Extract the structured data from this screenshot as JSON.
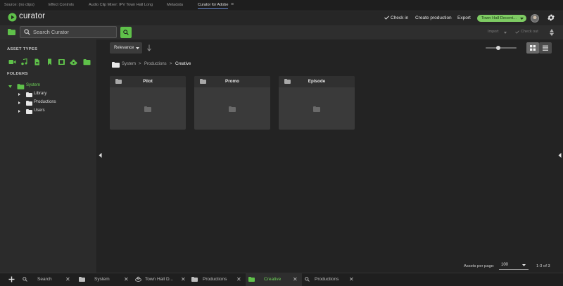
{
  "panel_tabs": [
    "Source: (no clips)",
    "Effect Controls",
    "Audio Clip Mixer: IPV Town Hall Long",
    "Metadata",
    "Curator for Adobe"
  ],
  "panel_menu_glyph": "≡",
  "app": {
    "logo_text": "curator"
  },
  "header": {
    "check_in": "Check in",
    "create_production": "Create production",
    "export": "Export",
    "user_selector": "Town Hall Decent..."
  },
  "search": {
    "placeholder": "Search Curator",
    "value": ""
  },
  "actions": {
    "import": "Import",
    "check_out": "Check out"
  },
  "sidebar": {
    "asset_types_label": "ASSET TYPES",
    "asset_type_icons": [
      "video-icon",
      "audio-icon",
      "document-icon",
      "bookmark-icon",
      "film-icon",
      "sequence-icon",
      "folder-icon"
    ],
    "folders_label": "FOLDERS",
    "tree": {
      "root": "System",
      "children": [
        "Library",
        "Productions",
        "Users"
      ]
    }
  },
  "sort": {
    "label": "Relevance",
    "direction": "descending"
  },
  "breadcrumb": [
    "System",
    "Productions",
    "Creative"
  ],
  "breadcrumb_separator": ">",
  "folders": [
    {
      "title": "Pilot"
    },
    {
      "title": "Promo"
    },
    {
      "title": "Episode"
    }
  ],
  "zoom_slider": {
    "value": 0.4
  },
  "pagination": {
    "per_page_label": "Assets per page:",
    "per_page": "100",
    "range": "1-3 of 3"
  },
  "bottom_tabs": [
    {
      "label": "Search",
      "icon": "search-icon"
    },
    {
      "label": "System",
      "icon": "folder-icon"
    },
    {
      "label": "Town Hall D...",
      "icon": "sequence-icon"
    },
    {
      "label": "Productions",
      "icon": "folder-icon"
    },
    {
      "label": "Creative",
      "icon": "folder-icon",
      "active": true
    },
    {
      "label": "Productions",
      "icon": "search-icon"
    }
  ],
  "colors": {
    "accent": "#5fc14a",
    "user_badge": "#7ecb63",
    "background": "#232323",
    "sidebar": "#2b2b2b"
  }
}
